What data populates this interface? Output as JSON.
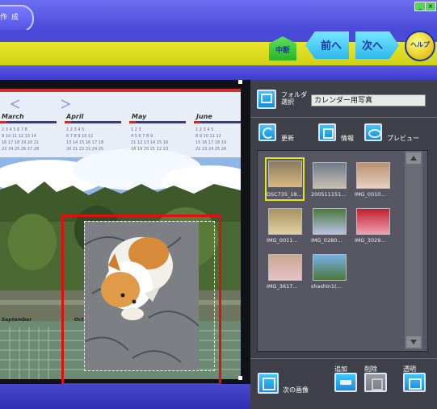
{
  "topbar": {
    "tab_label": "作 成",
    "min_label": "_",
    "close_label": "×"
  },
  "nav": {
    "chudan": "中断",
    "prev": "前へ",
    "next": "次へ",
    "help": "ヘルプ"
  },
  "calendar": {
    "months_top": [
      "March",
      "April",
      "May",
      "June"
    ],
    "months_bottom": [
      "September",
      "October"
    ]
  },
  "folder": {
    "label": "フォルダ選択",
    "value": "カレンダー用写真"
  },
  "toolbar": {
    "refresh": "更新",
    "info": "情報",
    "preview": "プレビュー"
  },
  "thumbnails": [
    {
      "caption": "DSC735_18..."
    },
    {
      "caption": "200511151..."
    },
    {
      "caption": "IMG_0010..."
    },
    {
      "caption": "IMG_0011..."
    },
    {
      "caption": "IMG_0280..."
    },
    {
      "caption": "IMG_3029..."
    },
    {
      "caption": "IMG_3617..."
    },
    {
      "caption": "shashin1(..."
    }
  ],
  "bottom": {
    "next_image": "次の画像",
    "add": "追加",
    "delete": "削除",
    "transparent": "透明"
  },
  "colors": {
    "accent_yellow": "#dede1c",
    "accent_blue": "#4a4ad8",
    "selection_red": "#e01010"
  }
}
